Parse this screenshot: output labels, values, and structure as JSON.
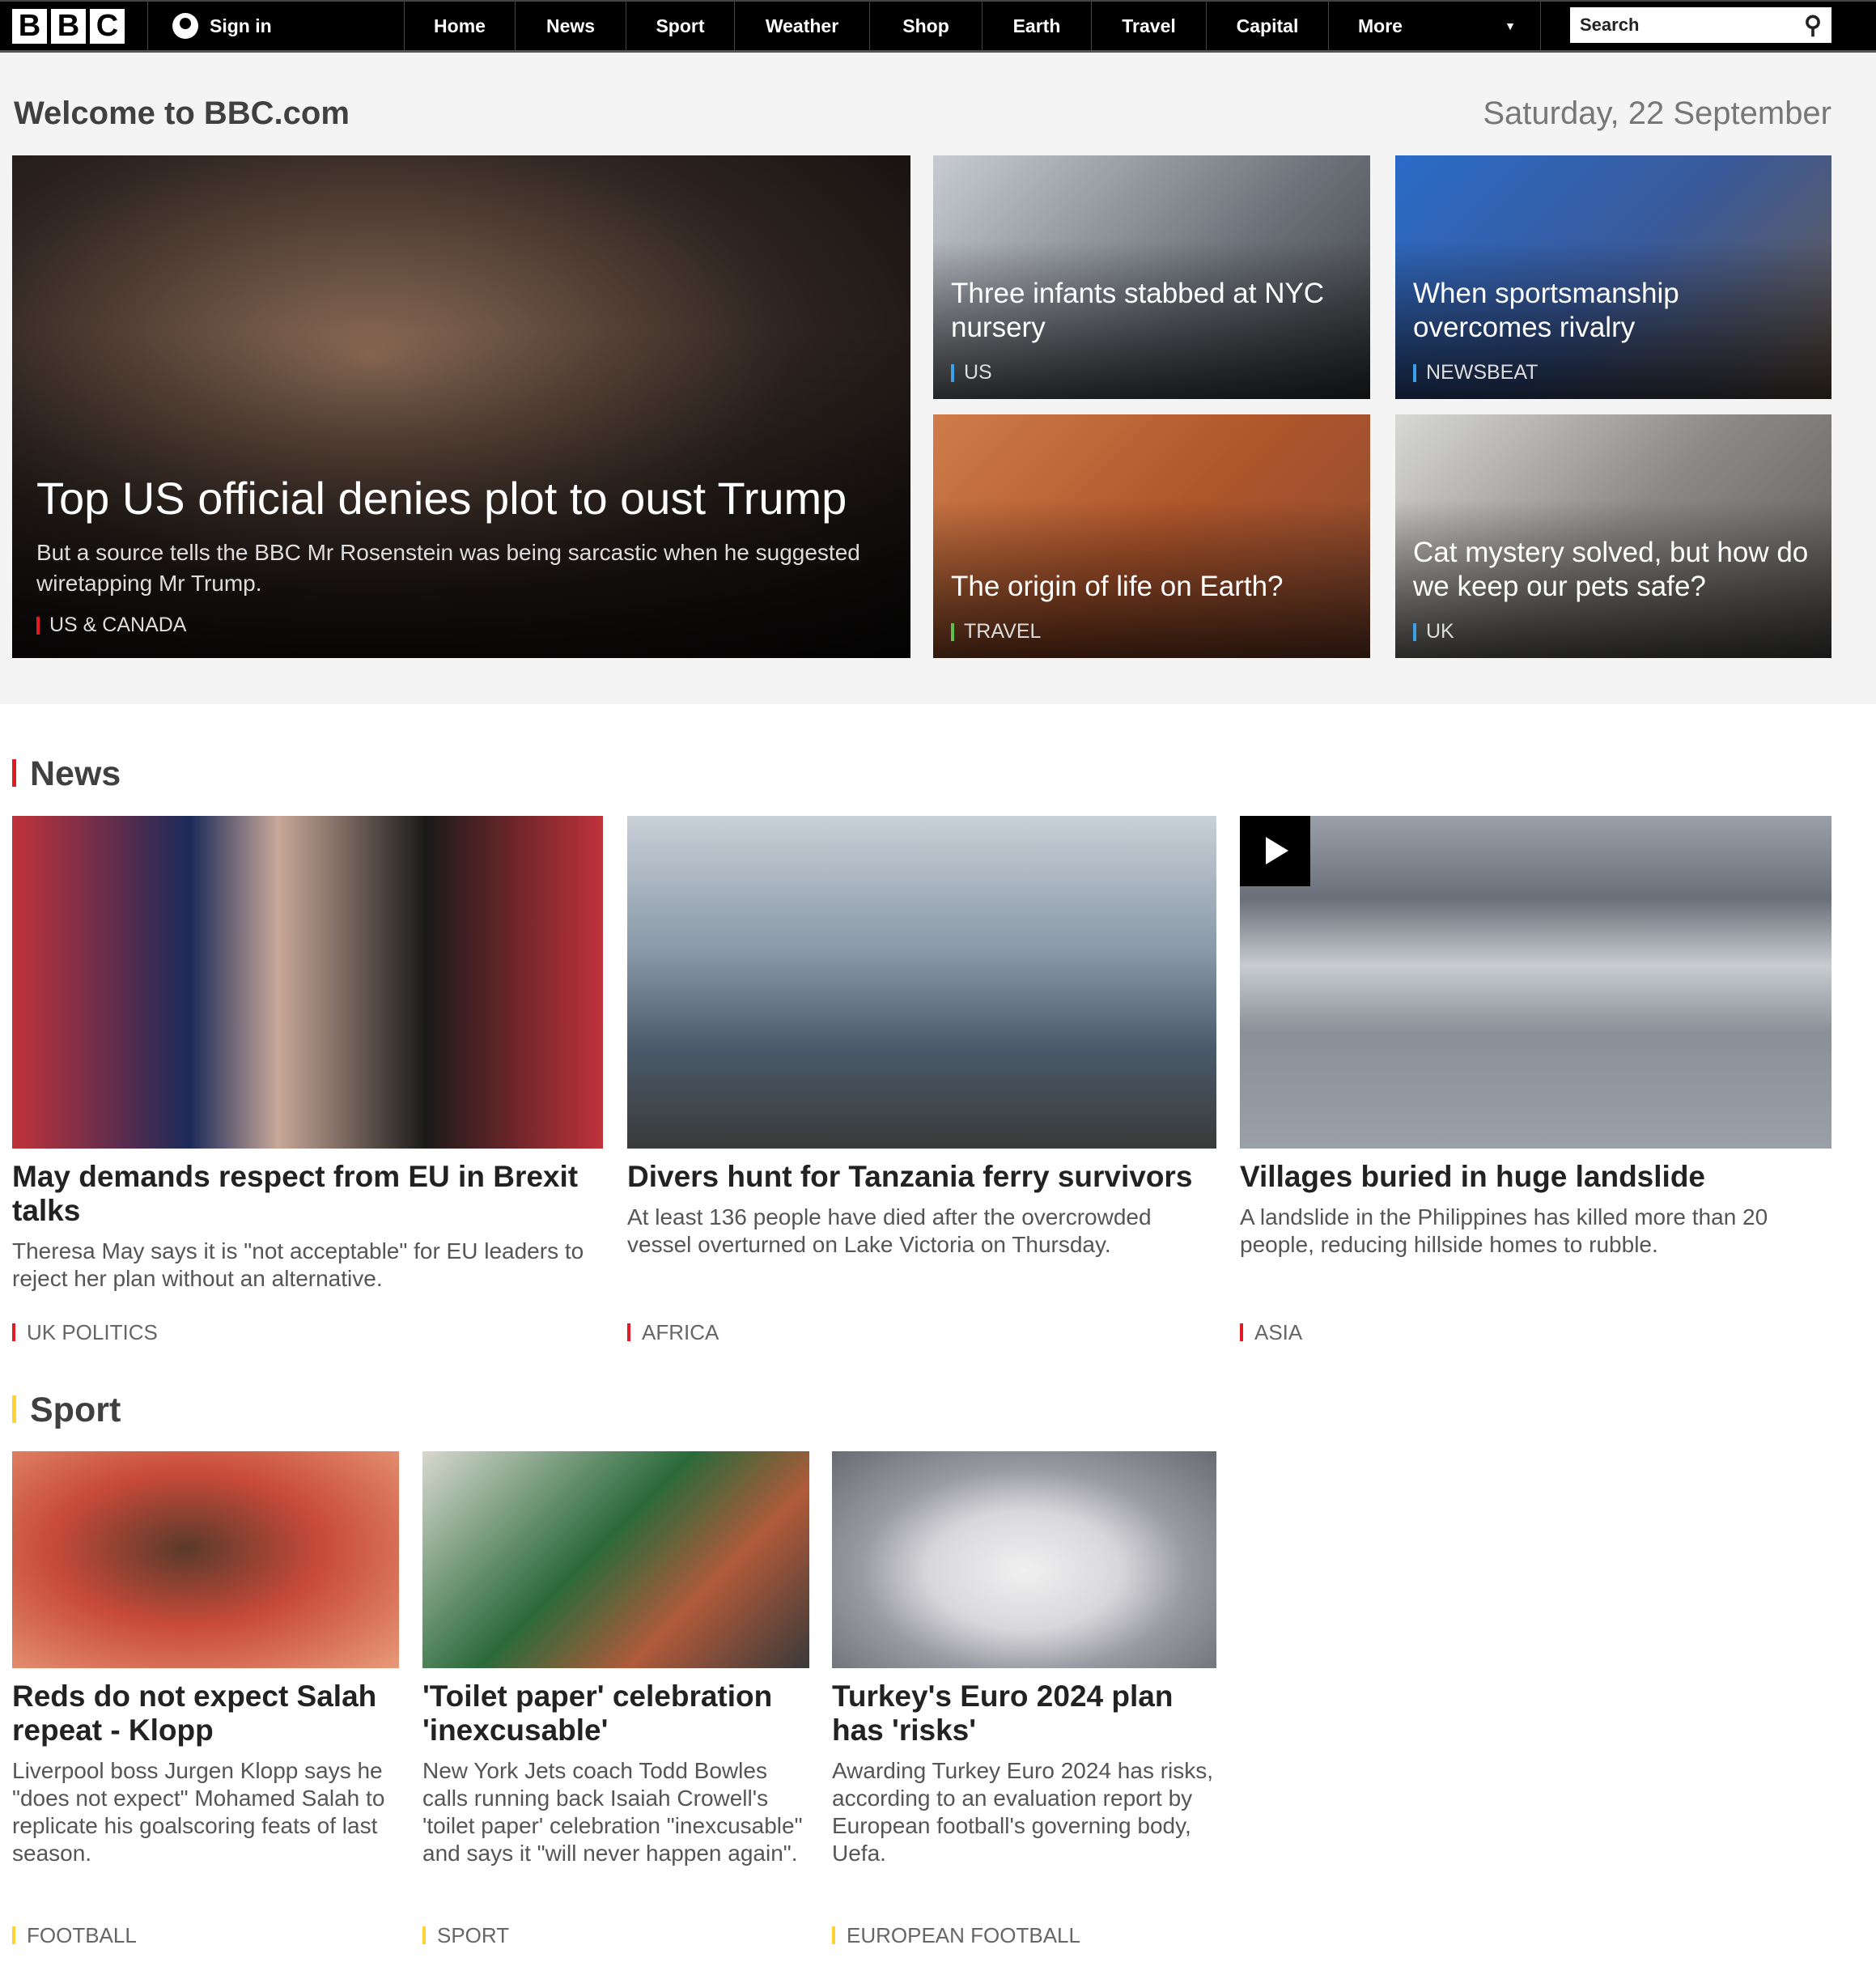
{
  "nav": {
    "logo": "BBC",
    "sign_in": "Sign in",
    "items": [
      "Home",
      "News",
      "Sport",
      "Weather",
      "Shop",
      "Earth",
      "Travel",
      "Capital",
      "More"
    ],
    "search_placeholder": "Search"
  },
  "header": {
    "welcome": "Welcome to BBC.com",
    "date": "Saturday, 22 September"
  },
  "hero": {
    "title": "Top US official denies plot to oust Trump",
    "summary": "But a source tells the BBC Mr Rosenstein was being sarcastic when he suggested wiretapping Mr Trump.",
    "tag": "US & CANADA"
  },
  "tiles": [
    {
      "title": "Three infants stabbed at NYC nursery",
      "tag": "US"
    },
    {
      "title": "When sportsmanship overcomes rivalry",
      "tag": "NEWSBEAT"
    },
    {
      "title": "The origin of life on Earth?",
      "tag": "TRAVEL"
    },
    {
      "title": "Cat mystery solved, but how do we keep our pets safe?",
      "tag": "UK"
    }
  ],
  "news": {
    "heading": "News",
    "color": "#e01b22",
    "cards": [
      {
        "title": "May demands respect from EU in Brexit talks",
        "summary": "Theresa May says it is \"not acceptable\" for EU leaders to reject her plan without an alternative.",
        "tag": "UK POLITICS"
      },
      {
        "title": "Divers hunt for Tanzania ferry survivors",
        "summary": "At least 136 people have died after the overcrowded vessel overturned on Lake Victoria on Thursday.",
        "tag": "AFRICA"
      },
      {
        "title": "Villages buried in huge landslide",
        "summary": "A landslide in the Philippines has killed more than 20 people, reducing hillside homes to rubble.",
        "tag": "ASIA",
        "video": true
      }
    ]
  },
  "sport": {
    "heading": "Sport",
    "color": "#ffd230",
    "cards": [
      {
        "title": "Reds do not expect Salah repeat - Klopp",
        "summary": "Liverpool boss Jurgen Klopp says he \"does not expect\" Mohamed Salah to replicate his goalscoring feats of last season.",
        "tag": "FOOTBALL"
      },
      {
        "title": "'Toilet paper' celebration 'inexcusable'",
        "summary": "New York Jets coach Todd Bowles calls running back Isaiah Crowell's 'toilet paper' celebration \"inexcusable\" and says it \"will never happen again\".",
        "tag": "SPORT"
      },
      {
        "title": "Turkey's Euro 2024 plan has 'risks'",
        "summary": "Awarding Turkey Euro 2024 has risks, according to an evaluation report by European football's governing body, Uefa.",
        "tag": "EUROPEAN FOOTBALL"
      }
    ]
  }
}
